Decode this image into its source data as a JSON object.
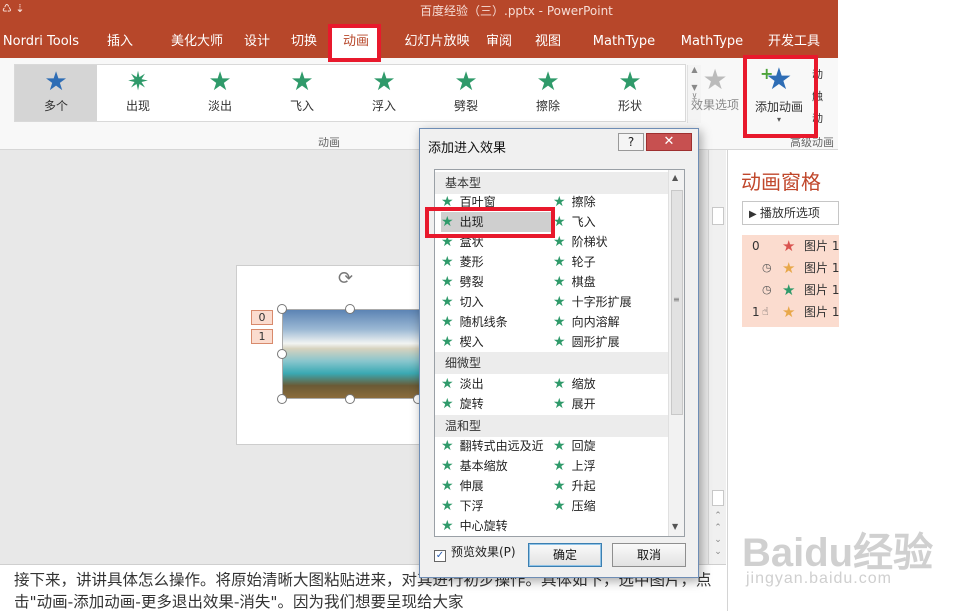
{
  "window": {
    "title": "百度经验（三）.pptx - PowerPoint",
    "quick_access": "♺ ⇣"
  },
  "tabs": [
    {
      "label": "Nordri Tools",
      "active": false
    },
    {
      "label": "插入",
      "active": false
    },
    {
      "label": "美化大师",
      "active": false
    },
    {
      "label": "设计",
      "active": false
    },
    {
      "label": "切换",
      "active": false
    },
    {
      "label": "动画",
      "active": true
    },
    {
      "label": "幻灯片放映",
      "active": false
    },
    {
      "label": "审阅",
      "active": false
    },
    {
      "label": "视图",
      "active": false
    },
    {
      "label": "MathType",
      "active": false
    },
    {
      "label": "MathType",
      "active": false
    },
    {
      "label": "开发工具",
      "active": false
    }
  ],
  "ribbon": {
    "gallery": [
      {
        "label": "多个",
        "icon": "star-icon",
        "selected": true
      },
      {
        "label": "出现",
        "icon": "star-burst-icon",
        "selected": false
      },
      {
        "label": "淡出",
        "icon": "star-icon",
        "selected": false
      },
      {
        "label": "飞入",
        "icon": "star-fly-icon",
        "selected": false
      },
      {
        "label": "浮入",
        "icon": "star-float-icon",
        "selected": false
      },
      {
        "label": "劈裂",
        "icon": "star-split-icon",
        "selected": false
      },
      {
        "label": "擦除",
        "icon": "star-wipe-icon",
        "selected": false
      },
      {
        "label": "形状",
        "icon": "star-shape-icon",
        "selected": false
      }
    ],
    "group_animation": "动画",
    "effect_options": "效果选项",
    "add_animation": "添加动画",
    "group_advanced": "高级动画",
    "advanced_items": [
      "动",
      "触",
      "动"
    ]
  },
  "notes": "接下来，讲讲具体怎么操作。将原始清晰大图粘贴进来，对其进行初步操作。具体如下，选中图片，点击\"动画-添加动画-更多退出效果-消失\"。因为我们想要呈现给大家",
  "slide": {
    "tags": [
      "0",
      "1"
    ]
  },
  "pane": {
    "title": "动画窗格",
    "play_from": "播放所选项",
    "items": [
      {
        "num": "0",
        "clock": "",
        "star_color": "#d9534f",
        "label": "图片 1"
      },
      {
        "num": "",
        "clock": "◷",
        "star_color": "#e8a84a",
        "label": "图片 1"
      },
      {
        "num": "",
        "clock": "◷",
        "star_color": "#2f9a6a",
        "label": "图片 1"
      },
      {
        "num": "1",
        "clock": "☝",
        "star_color": "#e8a84a",
        "label": "图片 1"
      }
    ]
  },
  "dialog": {
    "title": "添加进入效果",
    "help": "?",
    "close": "✕",
    "categories": [
      {
        "label": "基本型",
        "top": 0
      },
      {
        "label": "细微型",
        "top": 0
      },
      {
        "label": "温和型",
        "top": 0
      }
    ],
    "basic_left": [
      "百叶窗",
      "出现",
      "盒状",
      "菱形",
      "劈裂",
      "切入",
      "随机线条",
      "楔入"
    ],
    "basic_right": [
      "擦除",
      "飞入",
      "阶梯状",
      "轮子",
      "棋盘",
      "十字形扩展",
      "向内溶解",
      "圆形扩展"
    ],
    "subtle_left": [
      "淡出",
      "旋转"
    ],
    "subtle_right": [
      "缩放",
      "展开"
    ],
    "moderate_left": [
      "翻转式由远及近",
      "基本缩放",
      "伸展",
      "下浮",
      "中心旋转"
    ],
    "moderate_right": [
      "回旋",
      "上浮",
      "升起",
      "压缩"
    ],
    "selected_effect": "出现",
    "preview_label": "预览效果(P)",
    "preview_checked": true,
    "ok": "确定",
    "cancel": "取消"
  },
  "watermark": {
    "brand": "Baidu经验",
    "site": "jingyan.baidu.com"
  },
  "colors": {
    "accent": "#b7472a",
    "highlight": "#e8192c",
    "star_green": "#2f9a6a",
    "star_blue": "#2e6db5"
  }
}
